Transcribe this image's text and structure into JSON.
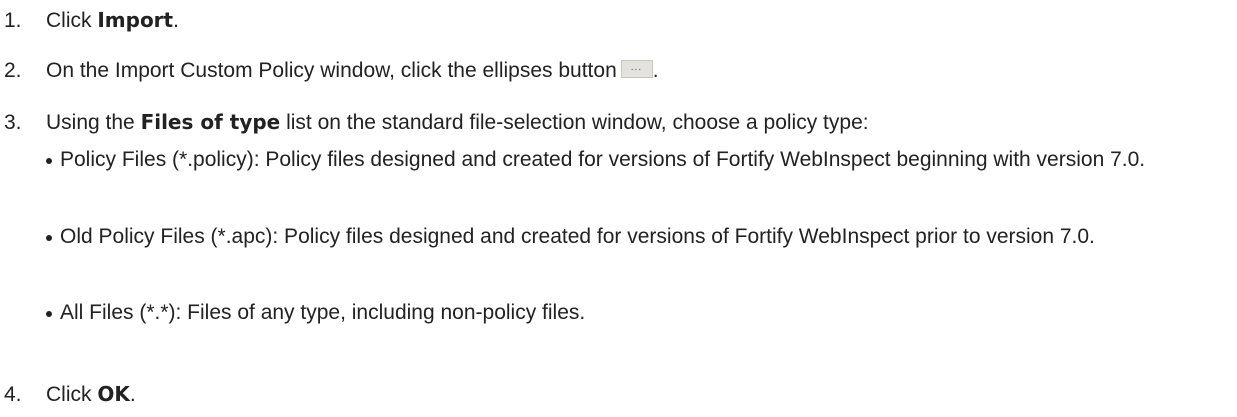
{
  "steps": [
    {
      "number": "1.",
      "pre": "Click ",
      "bold": "Import",
      "post": "."
    },
    {
      "number": "2.",
      "text": "On the Import Custom Policy window, click the ellipses button",
      "button_label": "...",
      "post": "."
    },
    {
      "number": "3.",
      "pre": "Using the ",
      "bold": "Files of type",
      "post": " list on the standard file-selection window, choose a policy type:"
    },
    {
      "number": "4.",
      "pre": "Click ",
      "bold": "OK",
      "post": "."
    }
  ],
  "bullets": [
    "Policy Files (*.policy): Policy files designed and created for versions of Fortify WebInspect beginning with version 7.0.",
    "Old Policy Files (*.apc): Policy files designed and created for versions of Fortify WebInspect prior to version 7.0.",
    "All Files (*.*): Files of any type, including non-policy files."
  ],
  "icons": {
    "ellipsis_button": "ellipsis-button-icon"
  },
  "colors": {
    "text": "#222222",
    "button_face": "#e4e2dc"
  }
}
